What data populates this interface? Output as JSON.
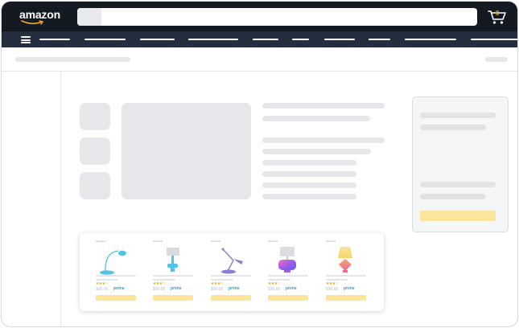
{
  "header": {
    "logo_text": "amazon",
    "search_placeholder": "",
    "cart_count": "0",
    "brand_color": "#131a22",
    "nav_color": "#232f3e",
    "accent": "#f5b300"
  },
  "carousel": {
    "cards": [
      {
        "label": "Sponsored",
        "stars": "★★★☆",
        "price": "$00.00",
        "prime": "prime",
        "lamp": "arc-lamp"
      },
      {
        "label": "Sponsored",
        "stars": "★★★☆",
        "price": "$00.00",
        "prime": "prime",
        "lamp": "desk-lamp"
      },
      {
        "label": "Sponsored",
        "stars": "★★★☆",
        "price": "$00.00",
        "prime": "prime",
        "lamp": "swing-arm-lamp"
      },
      {
        "label": "Sponsored",
        "stars": "★★★☆",
        "price": "$00.00",
        "prime": "prime",
        "lamp": "crystal-lamp"
      },
      {
        "label": "Sponsored",
        "stars": "★★★☆",
        "price": "$00.00",
        "prime": "prime",
        "lamp": "gradient-lamp"
      }
    ]
  },
  "icons": {
    "menu": "hamburger-icon",
    "cart": "cart-icon"
  }
}
